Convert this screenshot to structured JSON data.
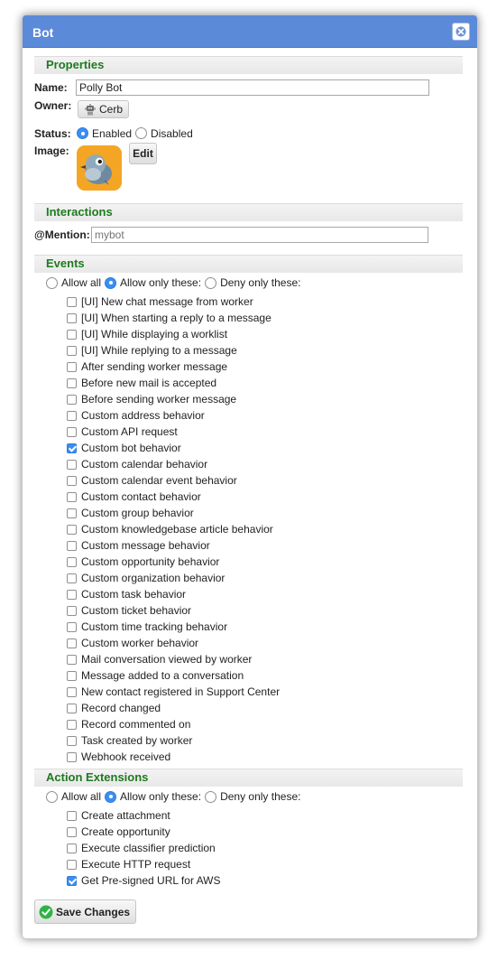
{
  "dialog": {
    "title": "Bot"
  },
  "properties": {
    "heading": "Properties",
    "name_label": "Name:",
    "name_value": "Polly Bot",
    "owner_label": "Owner:",
    "owner_value": "Cerb",
    "status_label": "Status:",
    "status_options": [
      "Enabled",
      "Disabled"
    ],
    "status_selected": "Enabled",
    "image_label": "Image:",
    "image_edit_label": "Edit"
  },
  "interactions": {
    "heading": "Interactions",
    "mention_label": "@Mention:",
    "mention_placeholder": "mybot"
  },
  "events": {
    "heading": "Events",
    "mode_options": [
      "Allow all",
      "Allow only these:",
      "Deny only these:"
    ],
    "mode_selected": "Allow only these:",
    "items": [
      {
        "label": "[UI] New chat message from worker",
        "checked": false
      },
      {
        "label": "[UI] When starting a reply to a message",
        "checked": false
      },
      {
        "label": "[UI] While displaying a worklist",
        "checked": false
      },
      {
        "label": "[UI] While replying to a message",
        "checked": false
      },
      {
        "label": "After sending worker message",
        "checked": false
      },
      {
        "label": "Before new mail is accepted",
        "checked": false
      },
      {
        "label": "Before sending worker message",
        "checked": false
      },
      {
        "label": "Custom address behavior",
        "checked": false
      },
      {
        "label": "Custom API request",
        "checked": false
      },
      {
        "label": "Custom bot behavior",
        "checked": true
      },
      {
        "label": "Custom calendar behavior",
        "checked": false
      },
      {
        "label": "Custom calendar event behavior",
        "checked": false
      },
      {
        "label": "Custom contact behavior",
        "checked": false
      },
      {
        "label": "Custom group behavior",
        "checked": false
      },
      {
        "label": "Custom knowledgebase article behavior",
        "checked": false
      },
      {
        "label": "Custom message behavior",
        "checked": false
      },
      {
        "label": "Custom opportunity behavior",
        "checked": false
      },
      {
        "label": "Custom organization behavior",
        "checked": false
      },
      {
        "label": "Custom task behavior",
        "checked": false
      },
      {
        "label": "Custom ticket behavior",
        "checked": false
      },
      {
        "label": "Custom time tracking behavior",
        "checked": false
      },
      {
        "label": "Custom worker behavior",
        "checked": false
      },
      {
        "label": "Mail conversation viewed by worker",
        "checked": false
      },
      {
        "label": "Message added to a conversation",
        "checked": false
      },
      {
        "label": "New contact registered in Support Center",
        "checked": false
      },
      {
        "label": "Record changed",
        "checked": false
      },
      {
        "label": "Record commented on",
        "checked": false
      },
      {
        "label": "Task created by worker",
        "checked": false
      },
      {
        "label": "Webhook received",
        "checked": false
      }
    ]
  },
  "actions": {
    "heading": "Action Extensions",
    "mode_options": [
      "Allow all",
      "Allow only these:",
      "Deny only these:"
    ],
    "mode_selected": "Allow only these:",
    "items": [
      {
        "label": "Create attachment",
        "checked": false
      },
      {
        "label": "Create opportunity",
        "checked": false
      },
      {
        "label": "Execute classifier prediction",
        "checked": false
      },
      {
        "label": "Execute HTTP request",
        "checked": false
      },
      {
        "label": "Get Pre-signed URL for AWS",
        "checked": true
      }
    ]
  },
  "footer": {
    "save_label": "Save Changes"
  },
  "colors": {
    "titlebar": "#5b8ad8",
    "heading_green": "#1f7a1f",
    "check_blue": "#3b8ef3",
    "avatar_orange": "#f5a524",
    "save_green": "#2fb344"
  },
  "icons": {
    "close": "close-icon",
    "owner": "robot-icon",
    "avatar": "bird-avatar",
    "save": "checkmark-circle-icon"
  }
}
